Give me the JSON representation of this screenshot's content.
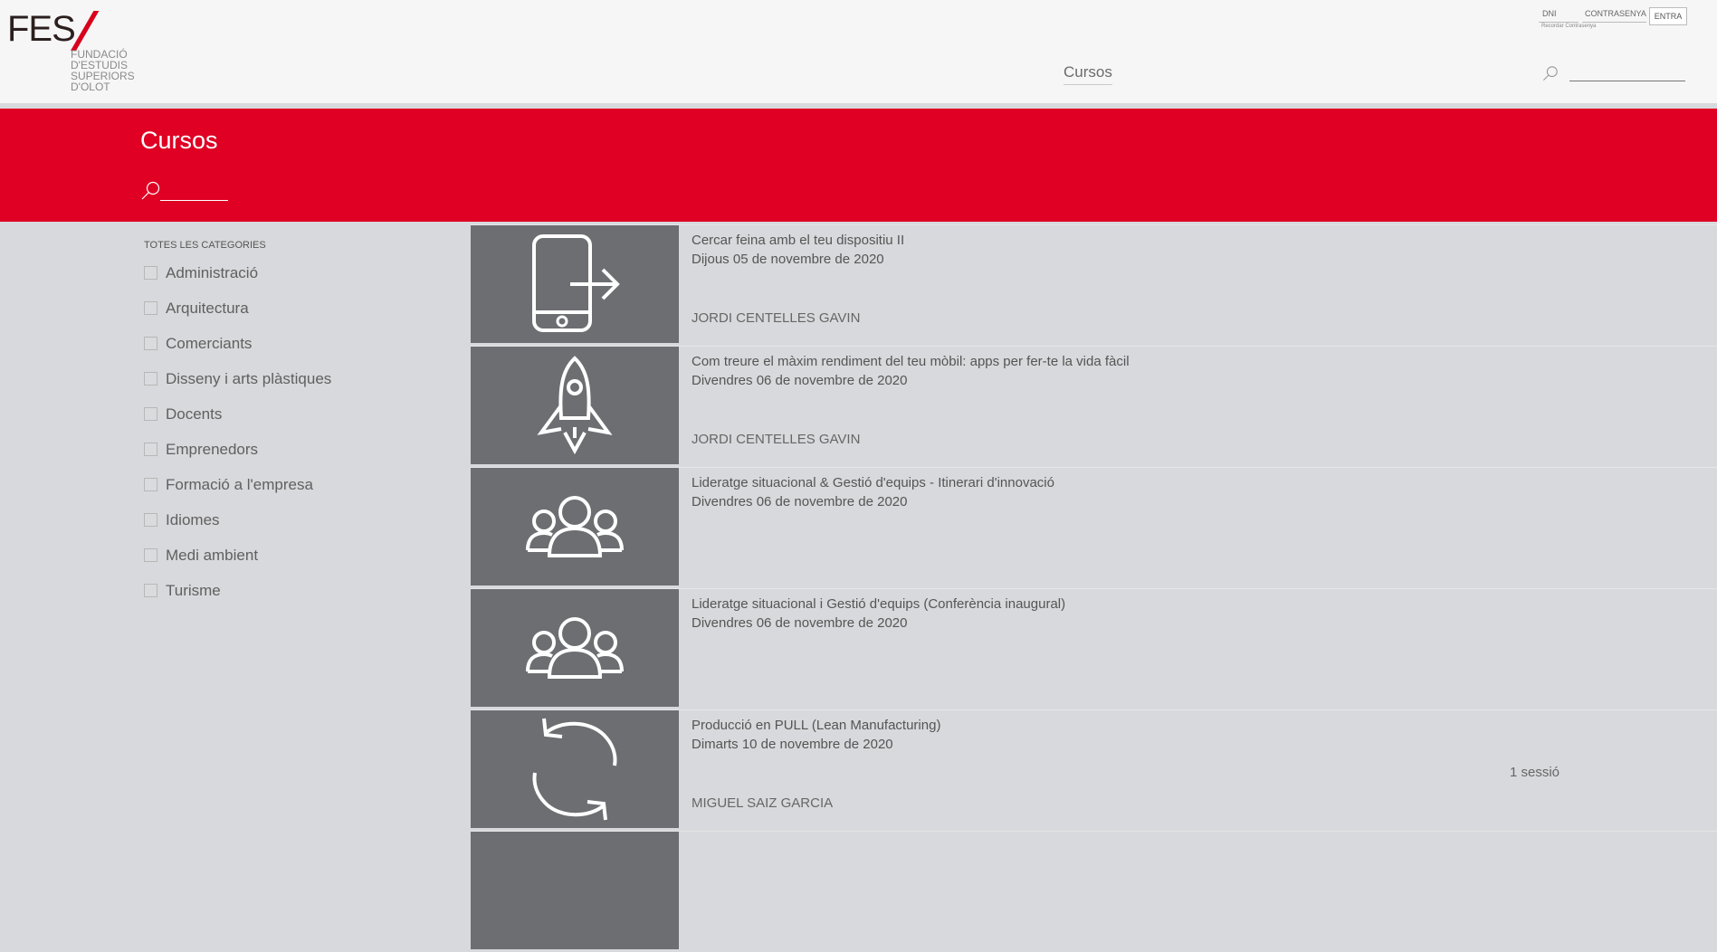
{
  "header": {
    "logo_text": "FES",
    "logo_sub": [
      "FUNDACIÓ",
      "D'ESTUDIS",
      "SUPERIORS",
      "D'OLOT"
    ],
    "nav_link": "Cursos",
    "login": {
      "dni_label": "DNI",
      "password_label": "CONTRASENYA",
      "submit_label": "ENTRA",
      "remember_label": "Recordar Contrasenya"
    }
  },
  "banner": {
    "title": "Cursos"
  },
  "sidebar": {
    "header": "TOTES LES CATEGORIES",
    "categories": [
      "Administració",
      "Arquitectura",
      "Comerciants",
      "Disseny i arts plàstiques",
      "Docents",
      "Emprenedors",
      "Formació a l'empresa",
      "Idiomes",
      "Medi ambient",
      "Turisme"
    ]
  },
  "courses": [
    {
      "title": "Cercar feina amb el teu dispositiu II",
      "date": "Dijous 05 de novembre de 2020",
      "teacher": "JORDI CENTELLES GAVIN",
      "sessions": "",
      "icon": "phone-exit-icon"
    },
    {
      "title": "Com treure el màxim rendiment del teu mòbil: apps per fer-te la vida fàcil",
      "date": "Divendres 06 de novembre de 2020",
      "teacher": "JORDI CENTELLES GAVIN",
      "sessions": "",
      "icon": "rocket-icon"
    },
    {
      "title": "Lideratge situacional & Gestió d'equips - Itinerari d'innovació",
      "date": "Divendres 06 de novembre de 2020",
      "teacher": "",
      "sessions": "",
      "icon": "group-icon"
    },
    {
      "title": "Lideratge situacional i Gestió d'equips (Conferència inaugural)",
      "date": "Divendres 06 de novembre de 2020",
      "teacher": "",
      "sessions": "",
      "icon": "group-icon"
    },
    {
      "title": "Producció en PULL (Lean Manufacturing)",
      "date": "Dimarts 10 de novembre de 2020",
      "teacher": "MIGUEL SAIZ GARCIA",
      "sessions": "1 sessió",
      "icon": "refresh-icon"
    }
  ],
  "colors": {
    "accent": "#df0024",
    "thumb_bg": "#6d6e72",
    "page_bg": "#d8d9dc"
  }
}
